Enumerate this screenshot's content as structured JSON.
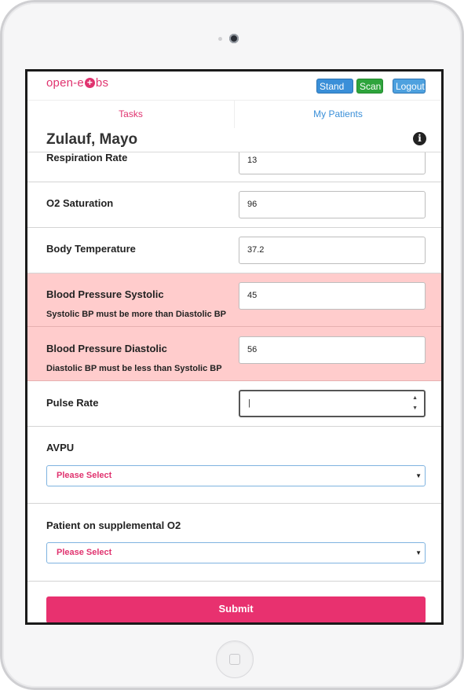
{
  "header": {
    "logo_text_left": "open-e",
    "logo_plus": "+",
    "logo_text_right": "bs",
    "buttons": {
      "stand_in": "Stand In",
      "scan": "Scan",
      "logout": "Logout"
    }
  },
  "tabs": [
    {
      "label": "Tasks",
      "active": true
    },
    {
      "label": "My Patients",
      "active": false
    }
  ],
  "patient": {
    "name": "Zulauf, Mayo",
    "info_icon": "i"
  },
  "form": {
    "respiration_rate": {
      "label": "Respiration Rate",
      "value": "13"
    },
    "o2_saturation": {
      "label": "O2 Saturation",
      "value": "96"
    },
    "body_temperature": {
      "label": "Body Temperature",
      "value": "37.2"
    },
    "bp_systolic": {
      "label": "Blood Pressure Systolic",
      "value": "45",
      "error": "Systolic BP must be more than Diastolic BP"
    },
    "bp_diastolic": {
      "label": "Blood Pressure Diastolic",
      "value": "56",
      "error": "Diastolic BP must be less than Systolic BP"
    },
    "pulse_rate": {
      "label": "Pulse Rate",
      "value": "",
      "spinner_up": "▲",
      "spinner_down": "▼"
    },
    "avpu": {
      "label": "AVPU",
      "selected": "Please Select",
      "caret": "▼"
    },
    "supplemental_o2": {
      "label": "Patient on supplemental O2",
      "selected": "Please Select",
      "caret": "▼"
    },
    "submit_label": "Submit"
  },
  "colors": {
    "brand_pink": "#e0336f",
    "error_bg": "#ffcccc",
    "stand_in_blue": "#3a8fd8",
    "scan_green": "#2ea43c",
    "logout_blue": "#4ea1df"
  }
}
